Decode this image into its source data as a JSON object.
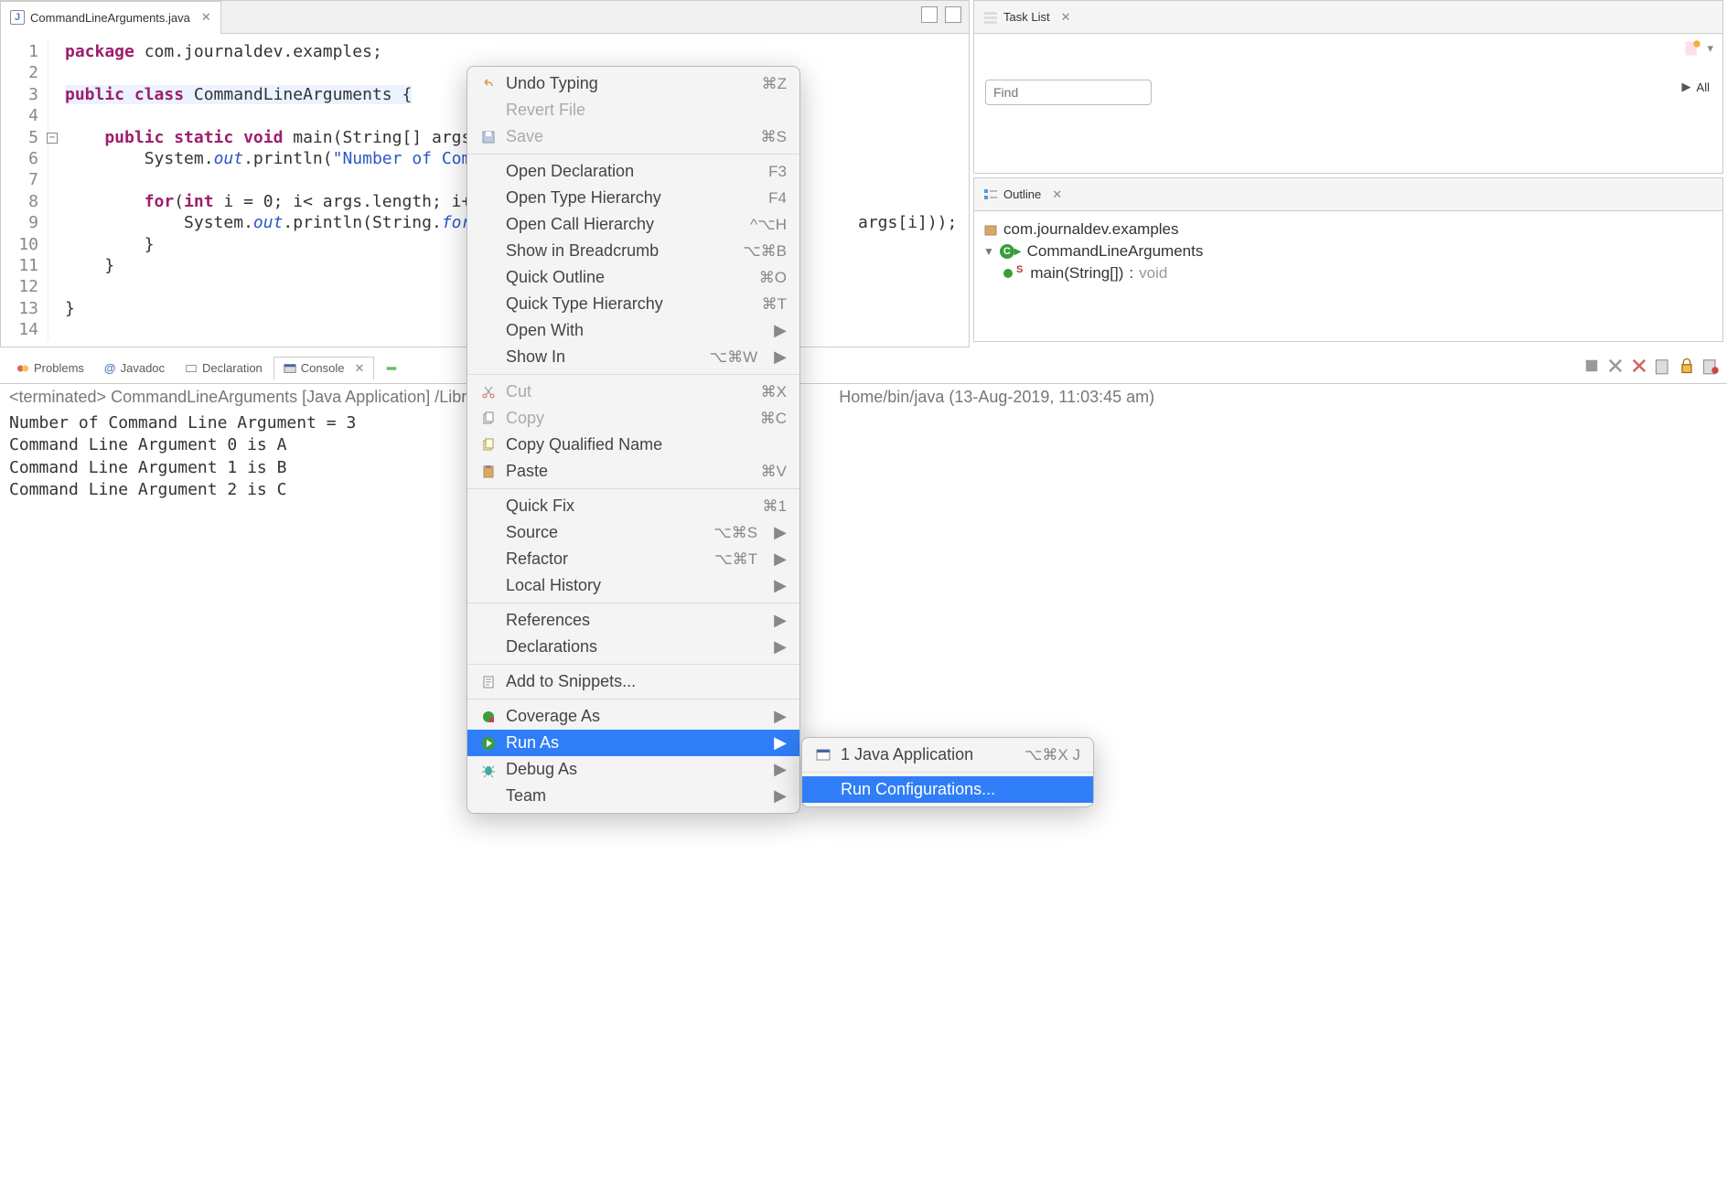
{
  "editor": {
    "tabTitle": "CommandLineArguments.java",
    "lineNumbers": [
      "1",
      "2",
      "3",
      "4",
      "5",
      "6",
      "7",
      "8",
      "9",
      "10",
      "11",
      "12",
      "13",
      "14"
    ],
    "code": {
      "l1a": "package",
      "l1b": " com.journaldev.examples;",
      "l3a": "public class",
      "l3b": " CommandLineArguments {",
      "l5a": "    public static void",
      "l5b": " main(String[] args) {",
      "l6a": "        System.",
      "l6b": "out",
      "l6c": ".println(",
      "l6d": "\"Number of Comman",
      "l8a": "        for",
      "l8b": "(",
      "l8c": "int",
      "l8d": " i = 0; i< args.length; i++)",
      "l9a": "            System.",
      "l9b": "out",
      "l9c": ".println(String.",
      "l9d": "format",
      "l9tail": " args[i]));",
      "l10": "        }",
      "l11": "    }",
      "l13": "}"
    }
  },
  "bottomTabs": {
    "problems": "Problems",
    "javadoc": "Javadoc",
    "declaration": "Declaration",
    "console": "Console"
  },
  "console": {
    "status": "<terminated> CommandLineArguments [Java Application] /Library/J",
    "statusTail": "Home/bin/java (13-Aug-2019, 11:03:45 am)",
    "lines": "Number of Command Line Argument = 3\nCommand Line Argument 0 is A\nCommand Line Argument 1 is B\nCommand Line Argument 2 is C"
  },
  "taskList": {
    "title": "Task List",
    "findPlaceholder": "Find",
    "all": "All"
  },
  "outline": {
    "title": "Outline",
    "pkg": "com.journaldev.examples",
    "cls": "CommandLineArguments",
    "methodName": "main(String[])",
    "methodSep": " : ",
    "methodReturn": "void"
  },
  "contextMenu": {
    "items": [
      {
        "label": "Undo Typing",
        "shortcut": "⌘Z",
        "icon": "undo",
        "disabled": false
      },
      {
        "label": "Revert File",
        "shortcut": "",
        "icon": "",
        "disabled": true
      },
      {
        "label": "Save",
        "shortcut": "⌘S",
        "icon": "save",
        "disabled": true
      },
      {
        "sep": true
      },
      {
        "label": "Open Declaration",
        "shortcut": "F3"
      },
      {
        "label": "Open Type Hierarchy",
        "shortcut": "F4"
      },
      {
        "label": "Open Call Hierarchy",
        "shortcut": "^⌥H"
      },
      {
        "label": "Show in Breadcrumb",
        "shortcut": "⌥⌘B"
      },
      {
        "label": "Quick Outline",
        "shortcut": "⌘O"
      },
      {
        "label": "Quick Type Hierarchy",
        "shortcut": "⌘T"
      },
      {
        "label": "Open With",
        "submenu": true
      },
      {
        "label": "Show In",
        "shortcut": "⌥⌘W",
        "submenu": true
      },
      {
        "sep": true
      },
      {
        "label": "Cut",
        "shortcut": "⌘X",
        "icon": "cut",
        "disabled": true
      },
      {
        "label": "Copy",
        "shortcut": "⌘C",
        "icon": "copy",
        "disabled": true
      },
      {
        "label": "Copy Qualified Name",
        "icon": "copyq"
      },
      {
        "label": "Paste",
        "shortcut": "⌘V",
        "icon": "paste"
      },
      {
        "sep": true
      },
      {
        "label": "Quick Fix",
        "shortcut": "⌘1"
      },
      {
        "label": "Source",
        "shortcut": "⌥⌘S",
        "submenu": true
      },
      {
        "label": "Refactor",
        "shortcut": "⌥⌘T",
        "submenu": true
      },
      {
        "label": "Local History",
        "submenu": true
      },
      {
        "sep": true
      },
      {
        "label": "References",
        "submenu": true
      },
      {
        "label": "Declarations",
        "submenu": true
      },
      {
        "sep": true
      },
      {
        "label": "Add to Snippets...",
        "icon": "snippet"
      },
      {
        "sep": true
      },
      {
        "label": "Coverage As",
        "icon": "coverage",
        "submenu": true
      },
      {
        "label": "Run As",
        "icon": "run",
        "submenu": true,
        "selected": true
      },
      {
        "label": "Debug As",
        "icon": "debug",
        "submenu": true
      },
      {
        "label": "Team",
        "submenu": true
      }
    ]
  },
  "submenu": {
    "items": [
      {
        "label": "1 Java Application",
        "shortcut": "⌥⌘X J",
        "icon": "java-app"
      },
      {
        "sep": true
      },
      {
        "label": "Run Configurations...",
        "selected": true
      }
    ]
  }
}
